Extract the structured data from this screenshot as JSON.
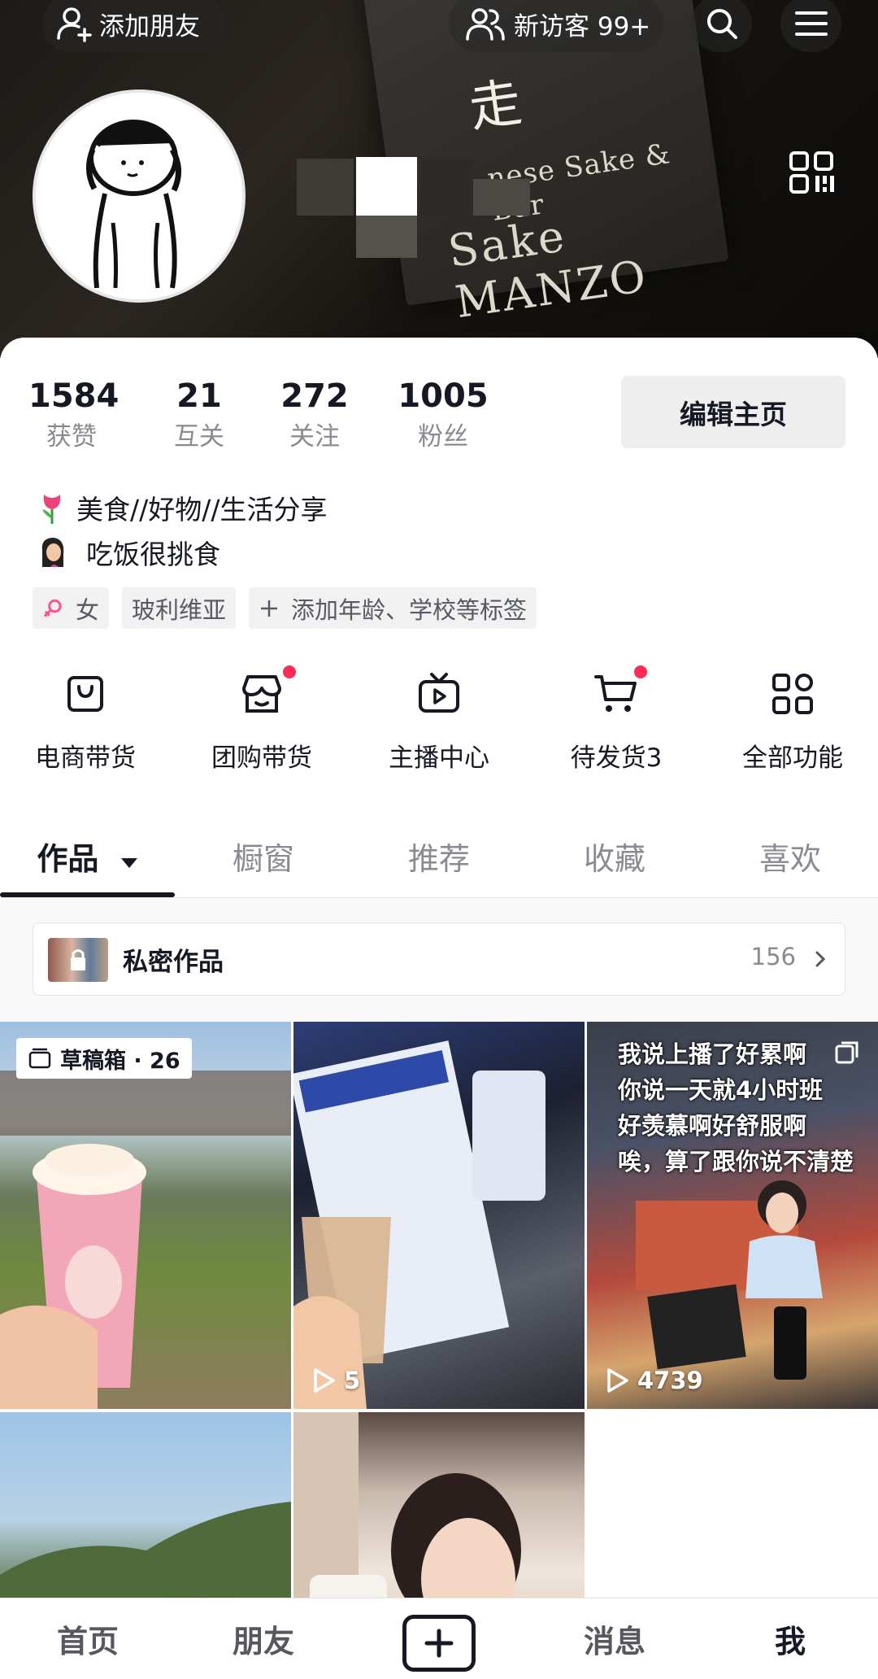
{
  "header": {
    "add_friend": "添加朋友",
    "visitors": "新访客 99+",
    "cover_sign_line1": "走",
    "cover_sign_line2": "nese Sake  & Bar",
    "cover_sign_line3": "Sake MANZO"
  },
  "stats": [
    {
      "value": "1584",
      "label": "获赞"
    },
    {
      "value": "21",
      "label": "互关"
    },
    {
      "value": "272",
      "label": "关注"
    },
    {
      "value": "1005",
      "label": "粉丝"
    }
  ],
  "edit_profile": "编辑主页",
  "bio": {
    "line1": "美食//好物//生活分享",
    "line2": "吃饭很挑食"
  },
  "tags": {
    "gender": "女",
    "location": "玻利维亚",
    "add": "添加年龄、学校等标签"
  },
  "features": [
    {
      "label": "电商带货",
      "icon": "bag-icon"
    },
    {
      "label": "团购带货",
      "icon": "store-icon"
    },
    {
      "label": "主播中心",
      "icon": "tv-play-icon"
    },
    {
      "label": "待发货3",
      "icon": "cart-icon"
    },
    {
      "label": "全部功能",
      "icon": "apps-grid-icon"
    }
  ],
  "tabs": [
    "作品",
    "橱窗",
    "推荐",
    "收藏",
    "喜欢"
  ],
  "private_works": {
    "label": "私密作品",
    "count": "156"
  },
  "videos": [
    {
      "badge": "草稿箱 · 26"
    },
    {
      "plays": "5"
    },
    {
      "plays": "4739",
      "overlay_lines": [
        "我说上播了好累啊",
        "你说一天就4小时班",
        "好羡慕啊好舒服啊",
        "唉，算了跟你说不清楚"
      ]
    }
  ],
  "bottom_nav": {
    "home": "首页",
    "friends": "朋友",
    "messages": "消息",
    "me": "我"
  },
  "colors": {
    "accent_red": "#fe2c55",
    "text": "#161823",
    "muted": "#8a8b91"
  }
}
